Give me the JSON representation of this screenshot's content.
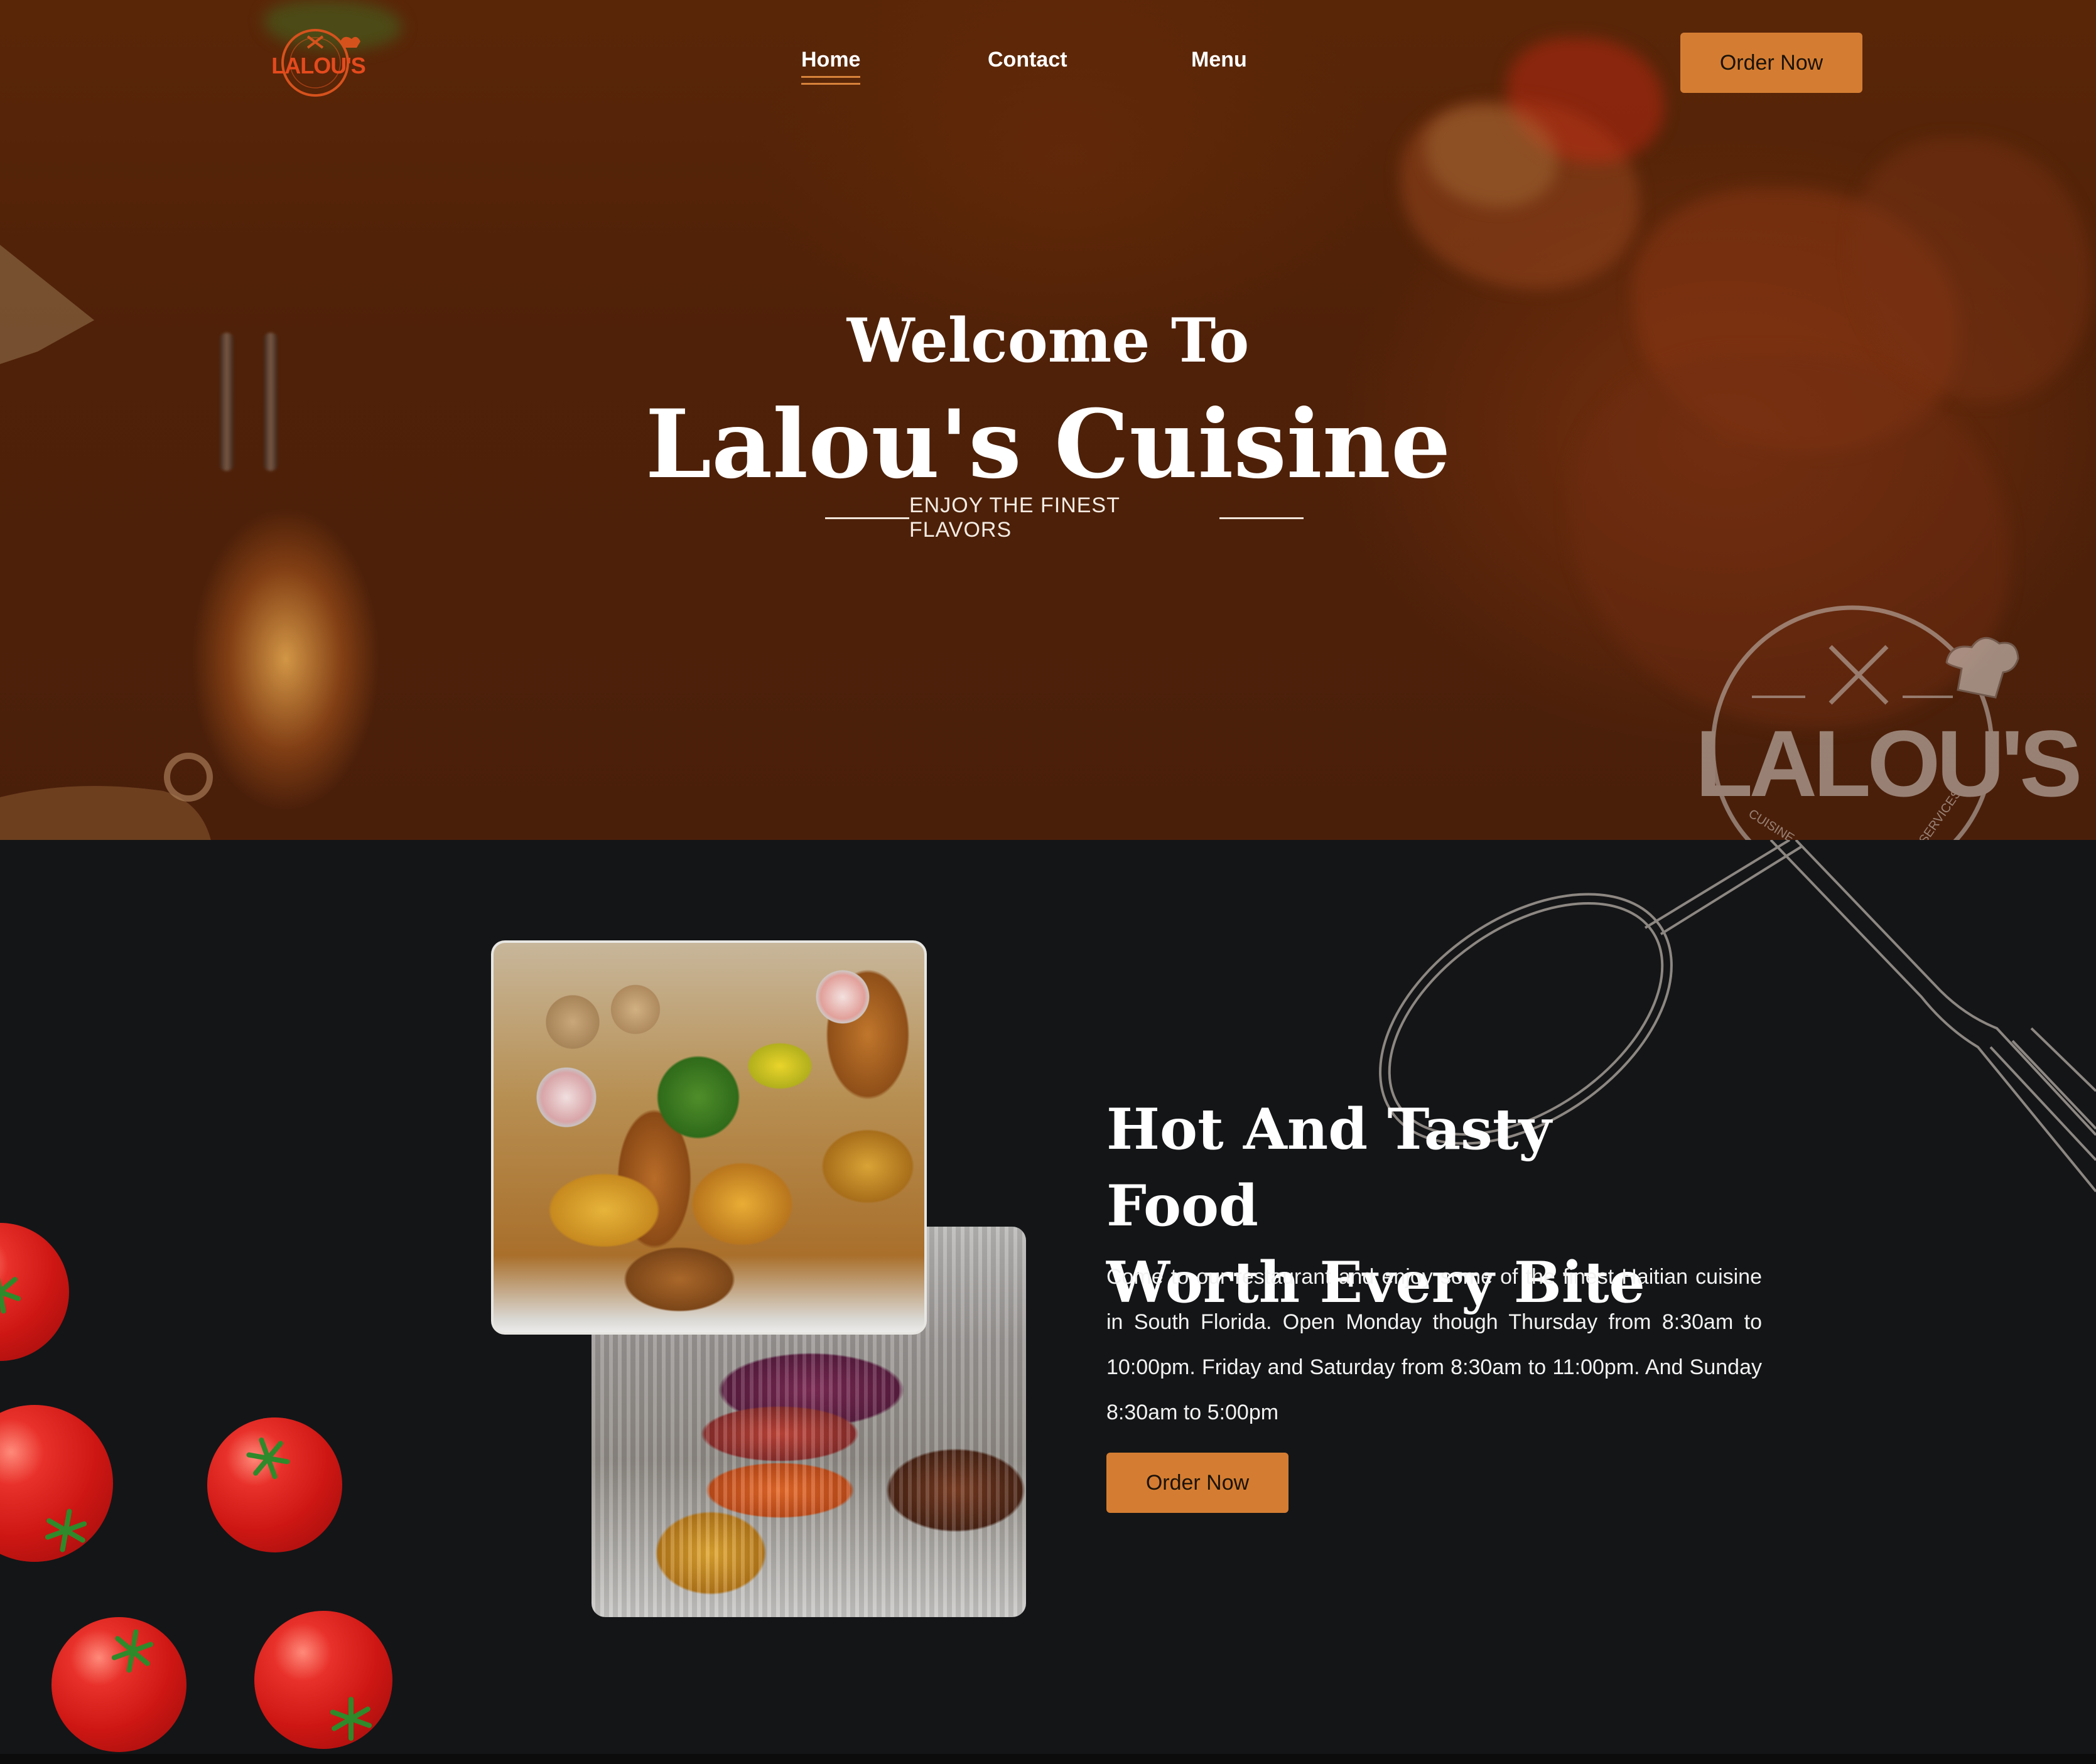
{
  "brand": {
    "logo_text": "LALOU'S",
    "accent": "#d47d32",
    "hero_bg": "#4f2108",
    "dark_bg": "#141517"
  },
  "nav": {
    "items": [
      {
        "label": "Home",
        "active": true
      },
      {
        "label": "Contact",
        "active": false
      },
      {
        "label": "Menu",
        "active": false
      }
    ],
    "order_button": "Order Now"
  },
  "hero": {
    "welcome": "Welcome To",
    "name": "Lalou's Cuisine",
    "tagline": "ENJOY THE FINEST FLAVORS",
    "watermark_text": "LALOU'S",
    "watermark_ring_left": "CUISINE",
    "watermark_ring_right": "SERVICES"
  },
  "about": {
    "headline_line1": "Hot And Tasty Food",
    "headline_line2": "Worth Every Bite",
    "body": "Come to our restaurant and enjoy some of the finest Haitian cuisine in South Florida. Open Monday though Thursday from 8:30am to 10:00pm. Friday and Saturday from 8:30am to 11:00pm. And Sunday 8:30am to 5:00pm",
    "order_button": "Order Now"
  },
  "icons": [
    "logo-icon",
    "fork-knife-icon",
    "chef-hat-icon",
    "spoon-icon",
    "fork-icon"
  ]
}
